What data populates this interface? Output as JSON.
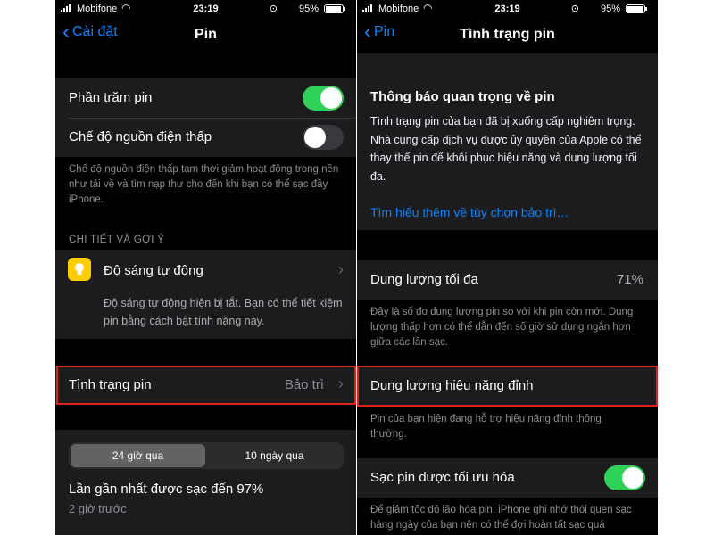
{
  "left": {
    "status": {
      "carrier": "Mobifone",
      "time": "23:19",
      "battery": "95%"
    },
    "nav": {
      "back": "Cài đặt",
      "title": "Pin"
    },
    "settings": {
      "battery_percentage": {
        "label": "Phần trăm pin",
        "on": true
      },
      "low_power_mode": {
        "label": "Chế độ nguồn điện thấp",
        "on": false
      },
      "low_power_footer": "Chế độ nguồn điện thấp tạm thời giảm hoạt động trong nền như tải về và tìm nạp thư cho đến khi bạn có thể sạc đầy iPhone."
    },
    "suggestions": {
      "header": "CHI TIẾT VÀ GỢI Ý",
      "item_label": "Độ sáng tự động",
      "item_desc": "Độ sáng tự động hiện bị tắt. Bạn có thể tiết kiệm pin bằng cách bật tính năng này.",
      "icon": "lightbulb-icon"
    },
    "battery_health": {
      "label": "Tình trạng pin",
      "value": "Bảo trì"
    },
    "usage": {
      "tabs": [
        "24 giờ qua",
        "10 ngày qua"
      ],
      "selected_tab": "24 giờ qua",
      "last_charged": "Lần gần nhất được sạc đến 97%",
      "last_charged_time": "2 giờ trước"
    }
  },
  "right": {
    "status": {
      "carrier": "Mobifone",
      "time": "23:19",
      "battery": "95%"
    },
    "nav": {
      "back": "Pin",
      "title": "Tình trạng pin"
    },
    "notice": {
      "title": "Thông báo quan trọng về pin",
      "body": "Tình trạng pin của bạn đã bị xuống cấp nghiêm trọng. Nhà cung cấp dịch vụ được ủy quyền của Apple có thể thay thế pin để khôi phục hiệu năng và dung lượng tối đa.",
      "link": "Tìm hiểu thêm về tùy chọn bảo trì…"
    },
    "max_capacity": {
      "label": "Dung lượng tối đa",
      "value": "71%",
      "footer": "Đây là số đo dung lượng pin so với khi pin còn mới. Dung lượng thấp hơn có thể dẫn đến số giờ sử dụng ngắn hơn giữa các lần sạc."
    },
    "peak_performance": {
      "label": "Dung lượng hiệu năng đỉnh",
      "footer": "Pin của bạn hiện đang hỗ trợ hiệu năng đỉnh thông thường."
    },
    "optimized_charging": {
      "label": "Sạc pin được tối ưu hóa",
      "on": true,
      "footer": "Để giảm tốc độ lão hóa pin, iPhone ghi nhớ thói quen sạc hàng ngày của bạn nên có thể đợi hoàn tất sạc quá"
    }
  },
  "colors": {
    "accent": "#0a84ff",
    "toggle_on": "#30d158",
    "highlight": "#e0201c",
    "cell_bg": "#1c1c1e"
  }
}
